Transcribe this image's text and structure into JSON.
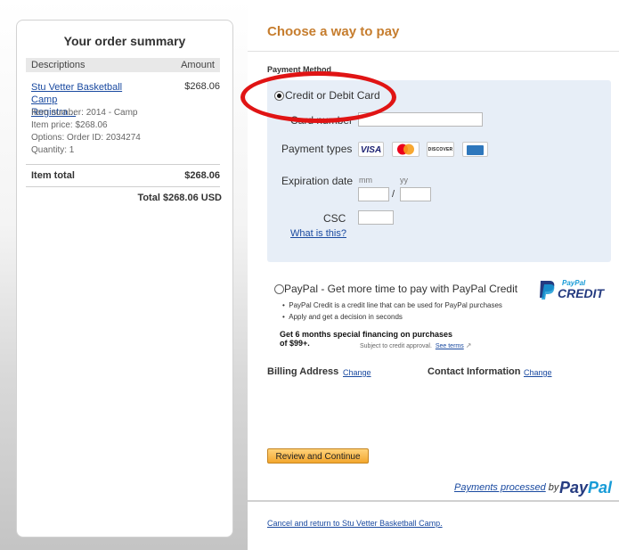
{
  "order_summary": {
    "title": "Your order summary",
    "col_descriptions": "Descriptions",
    "col_amount": "Amount",
    "item": {
      "name_line1": "Stu Vetter Basketball Camp",
      "name_line2": "Registra...",
      "amount": "$268.06",
      "item_number": "Item number: 2014 - Camp",
      "item_price": "Item price: $268.06",
      "options": "Options: Order ID: 2034274",
      "quantity": "Quantity: 1"
    },
    "item_total_label": "Item total",
    "item_total_value": "$268.06",
    "grand_total": "Total $268.06 USD"
  },
  "payment": {
    "title": "Choose a way to pay",
    "method_label": "Payment Method",
    "card_option": {
      "label": "Credit or Debit Card",
      "selected": true,
      "card_number_label": "Card number",
      "payment_types_label": "Payment types",
      "card_types": [
        "VISA",
        "MasterCard",
        "DISCOVER",
        "AMEX"
      ],
      "expiration_label": "Expiration date",
      "mm_hint": "mm",
      "yy_hint": "yy",
      "slash": "/",
      "csc_label": "CSC",
      "what_link": "What is this?"
    },
    "paypal_option": {
      "label": "PayPal - Get more time to pay with PayPal Credit",
      "selected": false,
      "bullets": [
        "PayPal Credit is a credit line that can be used for PayPal purchases",
        "Apply and get a decision in seconds"
      ],
      "promo_line1": "Get 6 months special financing on purchases",
      "promo_line2": "of $99+.",
      "promo_small": "Subject to credit approval.",
      "see_terms": "See terms",
      "logo_top": "PayPal",
      "logo_bottom": "CREDIT"
    },
    "billing_label": "Billing Address",
    "contact_label": "Contact Information",
    "change_label": "Change",
    "review_button": "Review and Continue",
    "processed_text": "Payments processed",
    "processed_by": "by",
    "paypal_logo_pay": "Pay",
    "paypal_logo_pal": "Pal",
    "cancel_link": "Cancel and return to Stu Vetter Basketball Camp."
  },
  "colors": {
    "accent_orange": "#c67d2e",
    "link_blue": "#1a4aa0",
    "card_box_bg": "#e7eef7",
    "highlight_red": "#e01414",
    "paypal_dark": "#253b80",
    "paypal_light": "#179bd7"
  }
}
